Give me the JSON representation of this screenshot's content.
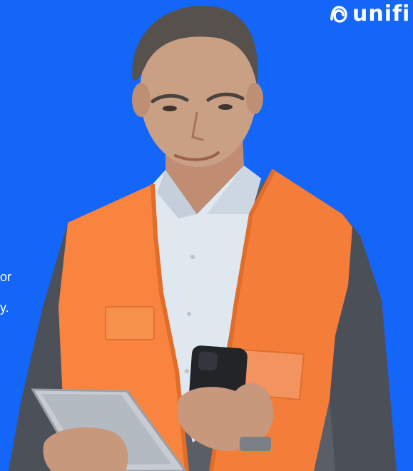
{
  "brand": {
    "logo_text": "unifi",
    "logo_icon": "unifize-swirl-icon"
  },
  "hero": {
    "copy_fragment_1": "or",
    "copy_fragment_2": "y."
  },
  "colors": {
    "background": "#1366f7",
    "vest": "#f8843f",
    "jacket": "#5a5e66",
    "shirt": "#dfe7ef",
    "skin": "#c99a7f",
    "hair": "#5b5550"
  }
}
